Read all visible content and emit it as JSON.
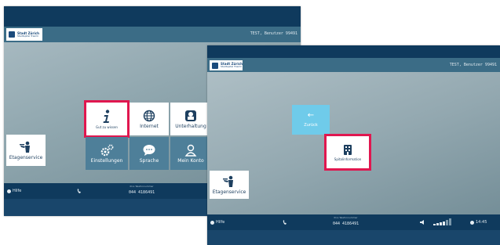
{
  "screen1": {
    "logo": {
      "line1": "Stadt Zürich",
      "line2": "Stadtspital Triemli"
    },
    "user_label": "TEST, Benutzer 99491",
    "tiles": [
      {
        "id": "info",
        "label": "Gut zu wissen",
        "icon": "info-icon"
      },
      {
        "id": "internet",
        "label": "Internet",
        "icon": "globe-icon"
      },
      {
        "id": "unterhaltung",
        "label": "Unterhaltung",
        "icon": "popcorn-icon"
      },
      {
        "id": "einstellungen",
        "label": "Einstellungen",
        "icon": "gears-icon"
      },
      {
        "id": "sprache",
        "label": "Sprache",
        "icon": "speech-bubble-icon"
      },
      {
        "id": "konto",
        "label": "Mein Konto",
        "icon": "person-icon"
      },
      {
        "id": "etagenservice",
        "label": "Etagenservice",
        "icon": "service-icon"
      }
    ],
    "bottom": {
      "hilfe": "Hilfe",
      "phone_caption": "Ihre Telefonnummer",
      "phone_number": "044 4186491"
    }
  },
  "screen2": {
    "logo": {
      "line1": "Stadt Zürich",
      "line2": "Stadtspital Triemli"
    },
    "user_label": "TEST, Benutzer 99491",
    "back": {
      "label": "Zurück",
      "icon": "arrow-left-icon"
    },
    "tiles": [
      {
        "id": "spitalinformation",
        "label": "Spitalinformation",
        "icon": "hospital-icon"
      },
      {
        "id": "etagenservice",
        "label": "Etagenservice",
        "icon": "service-icon"
      }
    ],
    "bottom": {
      "hilfe": "Hilfe",
      "phone_caption": "Ihre Telefonnummer",
      "phone_number": "044 4186491",
      "time": "14:45"
    }
  },
  "colors": {
    "topbar": "#0f3a5d",
    "subbar": "#3b6c86",
    "highlight": "#e0174f",
    "back_tile": "#6fcbea",
    "dark_tile": "#4e7f99"
  }
}
